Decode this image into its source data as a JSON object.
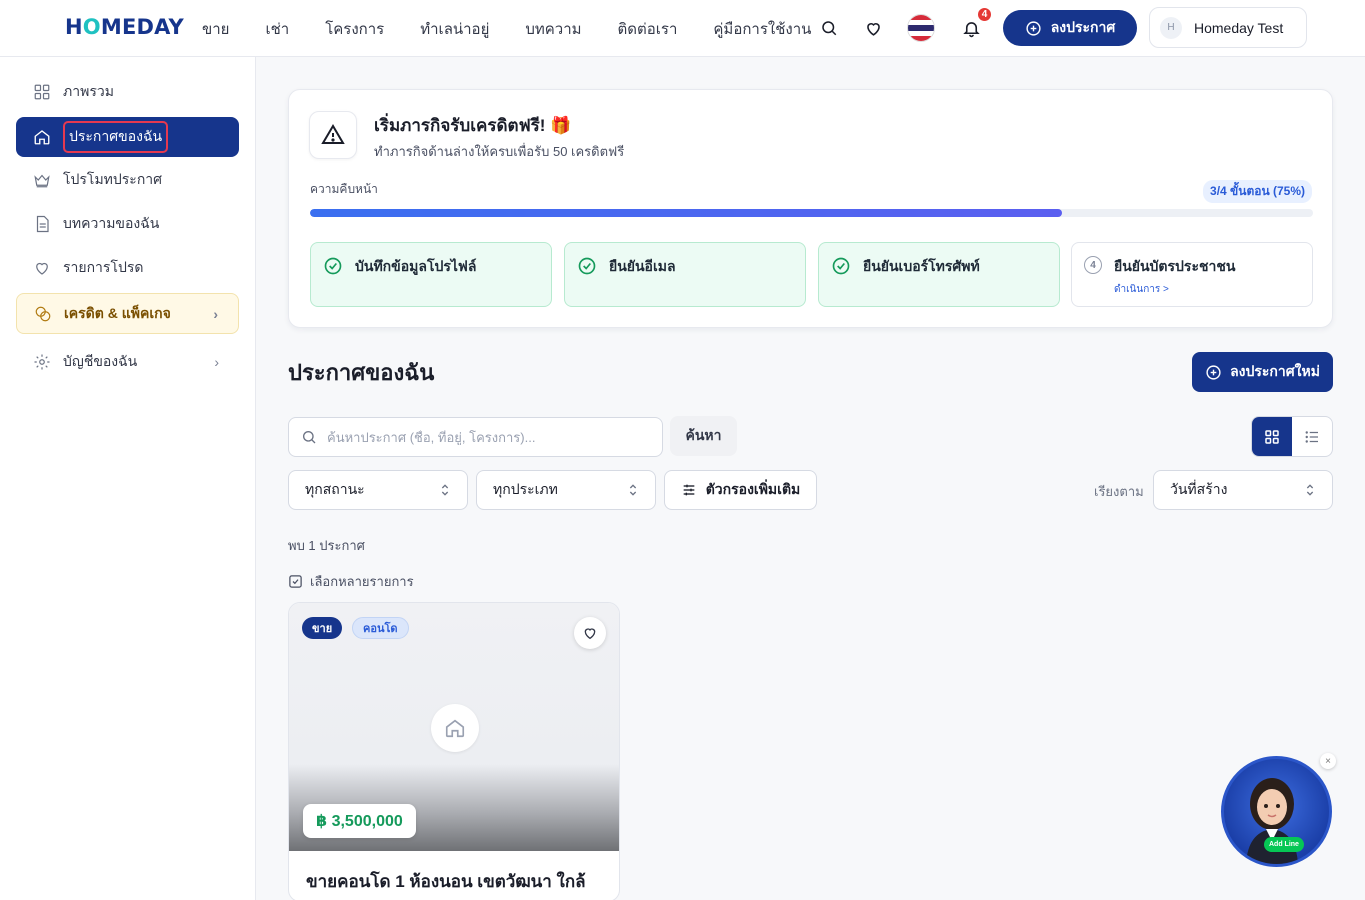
{
  "header": {
    "logo": "HOMEDAY",
    "nav": [
      "ขาย",
      "เช่า",
      "โครงการ",
      "ทำเลน่าอยู่",
      "บทความ",
      "ติดต่อเรา",
      "คู่มือการใช้งาน"
    ],
    "notification_count": "4",
    "post_button": "ลงประกาศ",
    "user_initial": "H",
    "user_name": "Homeday Test"
  },
  "sidebar": {
    "items": [
      {
        "label": "ภาพรวม",
        "icon": "grid-icon"
      },
      {
        "label": "ประกาศของฉัน",
        "icon": "home-icon",
        "active": true
      },
      {
        "label": "โปรโมทประกาศ",
        "icon": "crown-icon"
      },
      {
        "label": "บทความของฉัน",
        "icon": "document-icon"
      },
      {
        "label": "รายการโปรด",
        "icon": "heart-icon"
      },
      {
        "label": "เครดิต & แพ็คเกจ",
        "icon": "coins-icon"
      },
      {
        "label": "บัญชีของฉัน",
        "icon": "gear-icon"
      }
    ]
  },
  "onboarding": {
    "title": "เริ่มภารกิจรับเครดิตฟรี! 🎁",
    "subtitle": "ทำภารกิจด้านล่างให้ครบเพื่อรับ 50 เครดิตฟรี",
    "progress_label": "ความคืบหน้า",
    "progress_badge": "3/4 ขั้นตอน (75%)",
    "progress_value": 0.75,
    "steps": [
      {
        "label": "บันทึกข้อมูลโปรไฟล์",
        "done": true
      },
      {
        "label": "ยืนยันอีเมล",
        "done": true
      },
      {
        "label": "ยืนยันเบอร์โทรศัพท์",
        "done": true
      },
      {
        "label": "ยืนยันบัตรประชาชน",
        "done": false,
        "number": "4",
        "action": "ดำเนินการ >"
      }
    ]
  },
  "listings": {
    "title": "ประกาศของฉัน",
    "new_button": "ลงประกาศใหม่",
    "search_placeholder": "ค้นหาประกาศ (ชื่อ, ที่อยู่, โครงการ)...",
    "search_button": "ค้นหา",
    "status_filter": "ทุกสถานะ",
    "type_filter": "ทุกประเภท",
    "more_filters": "ตัวกรองเพิ่มเติม",
    "sort_label": "เรียงตาม",
    "sort_value": "วันที่สร้าง",
    "found_text": "พบ 1 ประกาศ",
    "multi_select": "เลือกหลายรายการ",
    "view_mode": "grid"
  },
  "card": {
    "tag_sale": "ขาย",
    "tag_type": "คอนโด",
    "price": "฿ 3,500,000",
    "title": "ขายคอนโด 1 ห้องนอน เขตวัฒนา ใกล้"
  },
  "chat": {
    "badge": "Add Line",
    "close": "×"
  },
  "colors": {
    "brand": "#16358c",
    "accent": "#1fc1c1",
    "success": "#159a5b",
    "danger": "#e53935"
  }
}
